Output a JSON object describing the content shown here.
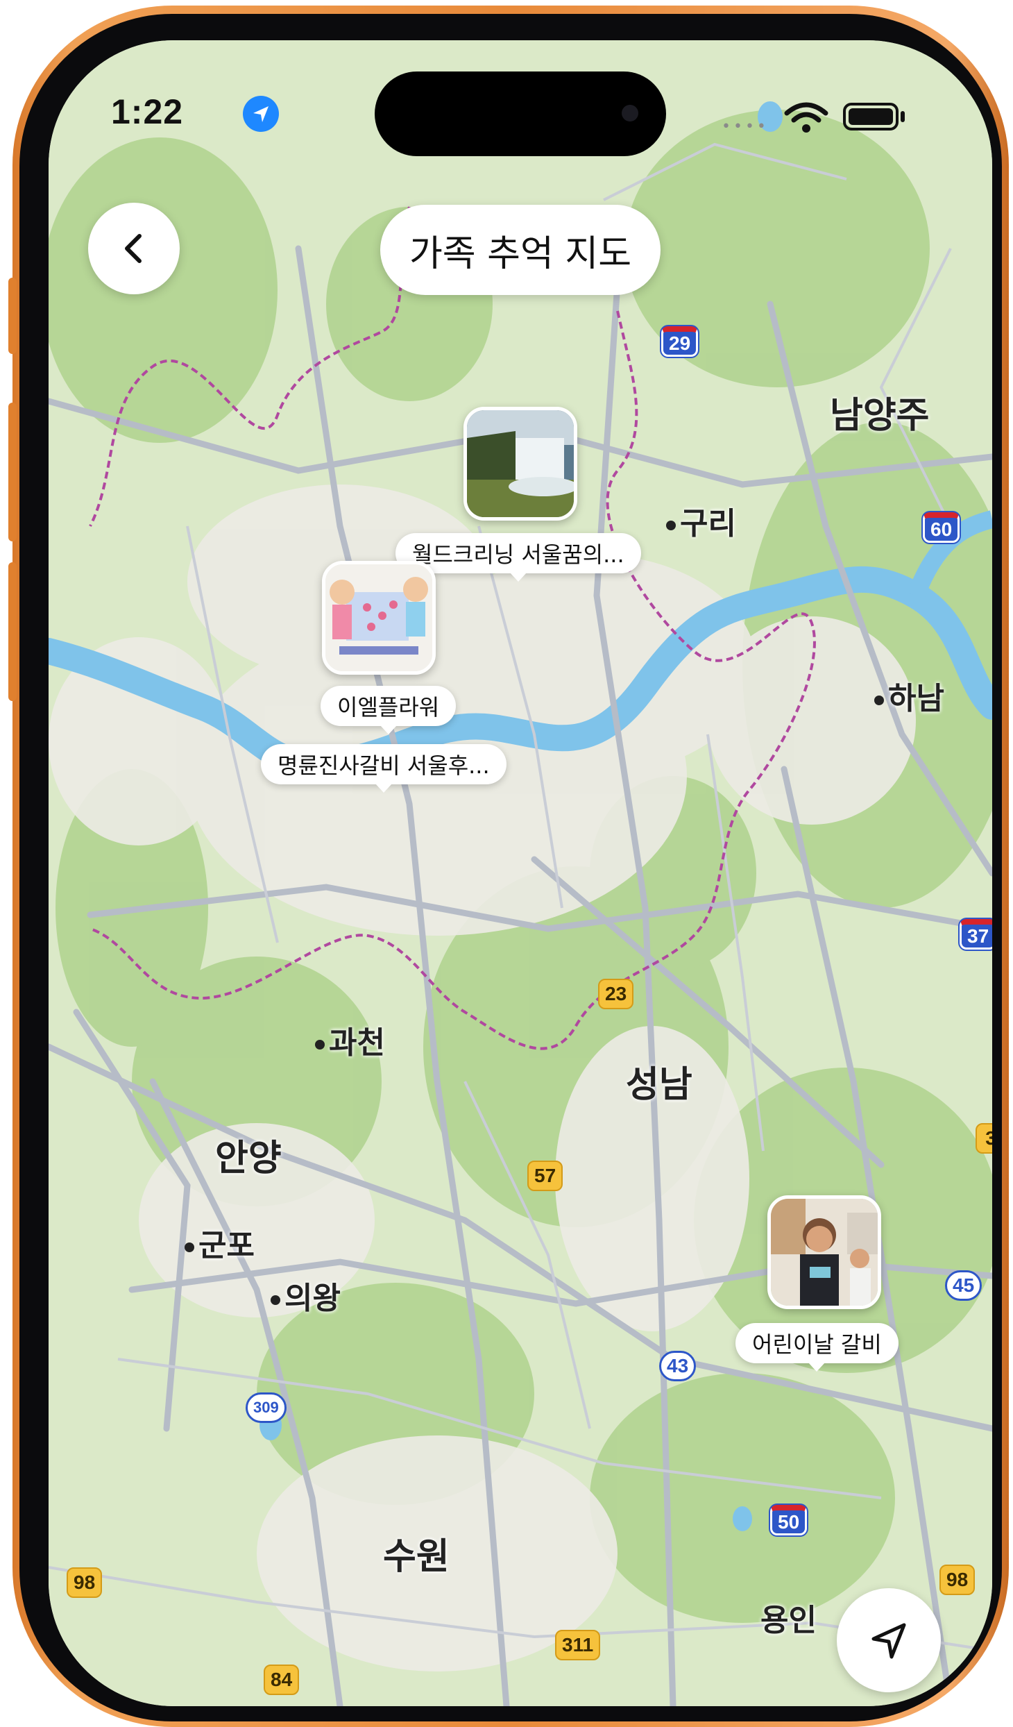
{
  "status_bar": {
    "time": "1:22"
  },
  "header": {
    "title": "가족 추억 지도"
  },
  "map": {
    "places": {
      "namyangju": "남양주",
      "guri": "구리",
      "hanam": "하남",
      "gwacheon": "과천",
      "seongnam": "성남",
      "anyang": "안양",
      "gunpo": "군포",
      "uiwang": "의왕",
      "suwon": "수원",
      "yongin": "용인"
    },
    "route_shields": {
      "r29": "29",
      "r60": "60",
      "r37": "37",
      "r23": "23",
      "r57": "57",
      "r45": "45",
      "r43": "43",
      "r309": "309",
      "r50": "50",
      "r98a": "98",
      "r98b": "98",
      "r311": "311",
      "r84": "84",
      "r3": "3"
    },
    "memory_pins": [
      {
        "label": "월드크리닝 서울꿈의..."
      },
      {
        "label": "이엘플라워"
      },
      {
        "label": "명륜진사갈비 서울후..."
      },
      {
        "label": "어린이날 갈비"
      }
    ]
  }
}
